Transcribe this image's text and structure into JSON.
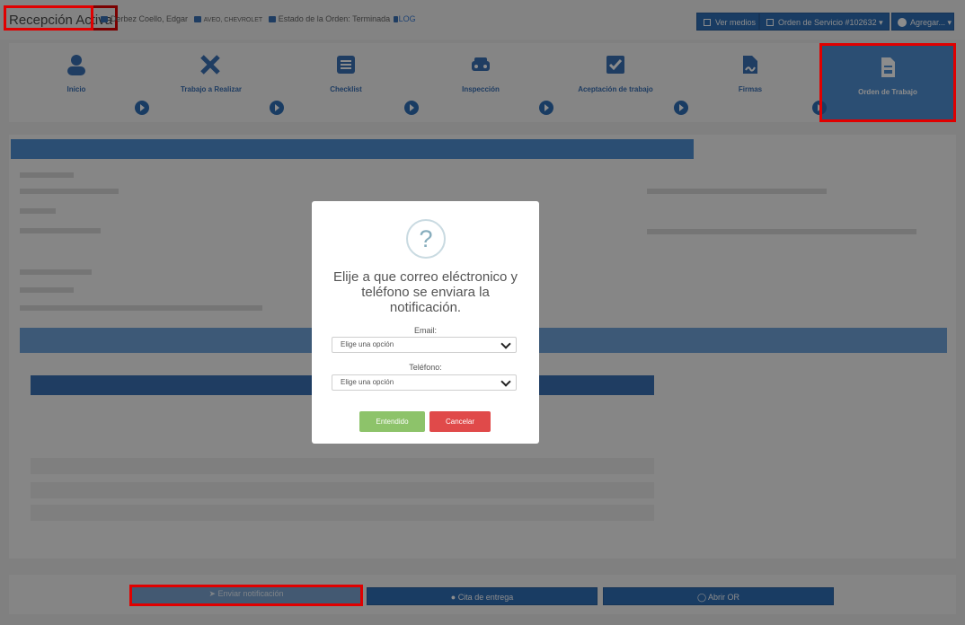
{
  "header": {
    "title": "Recepción Activa",
    "client": "Derbez Coello, Edgar",
    "vehicle": "AVEO, CHEVROLET",
    "order_status": "Estado de la Orden: Terminada",
    "log_label": "LOG"
  },
  "toolbar": {
    "ver_medios": "Ver medios",
    "orden_servicio": "Orden de Servicio #102632",
    "agregar": "Agregar..."
  },
  "steps": [
    {
      "label": "Inicio",
      "icon": "user-icon"
    },
    {
      "label": "Trabajo a Realizar",
      "icon": "tools-icon"
    },
    {
      "label": "Checklist",
      "icon": "list-icon"
    },
    {
      "label": "Inspección",
      "icon": "car-icon"
    },
    {
      "label": "Aceptación de trabajo",
      "icon": "check-square-icon"
    },
    {
      "label": "Firmas",
      "icon": "signature-icon"
    },
    {
      "label": "Orden de Trabajo",
      "icon": "document-icon"
    }
  ],
  "bottom": {
    "enviar": "Enviar notificación",
    "cita": "Cita de entrega",
    "abrir": "Abrir OR"
  },
  "modal": {
    "icon": "?",
    "title": "Elije a que correo eléctronico y teléfono se enviara la notificación.",
    "email_label": "Email:",
    "email_value": "Elige una opción",
    "phone_label": "Teléfono:",
    "phone_value": "Elige una opción",
    "confirm": "Entendido",
    "cancel": "Cancelar"
  },
  "colors": {
    "primary": "#2f6db5",
    "active_step": "#4f8ed1",
    "confirm": "#8dc36a",
    "cancel": "#e04a4a",
    "highlight": "#e00000"
  }
}
